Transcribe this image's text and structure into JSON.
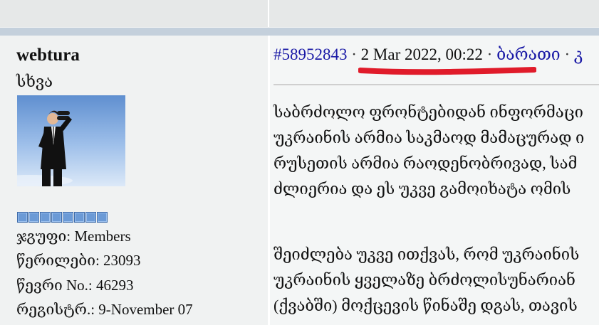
{
  "user": {
    "name": "webtura",
    "title": "სხვა",
    "rank_pips": 8,
    "stats": [
      "ჯგუფი: Members",
      "წერილები: 23093",
      "წევრი No.: 46293",
      "რეგისტრ.: 9-November 07"
    ]
  },
  "post": {
    "id_link": "#58952843",
    "separator": "·",
    "date": "2 Mar 2022, 00:22",
    "action_link": "ბარათი",
    "trailing_separator": "·",
    "trailing_fragment": "კ",
    "paragraph1": [
      "საბრძოლო ფრონტებიდან ინფორმაცი",
      "უკრაინის არმია საკმაოდ მამაცურად ი",
      "რუსეთის არმია რაოდენობრივად, სამ",
      "ძლიერია და ეს უკვე გამოიხატა ომის"
    ],
    "paragraph2": [
      "შეიძლება უკვე ითქვას, რომ უკრაინის",
      "უკრაინის ყველაზე ბრძოლისუნარიან",
      "(ქვაბში) მოქცევის წინაშე დგას, თავის"
    ]
  },
  "colors": {
    "link": "#1a1aa6",
    "underline_annotation": "#e01b2a",
    "band": "#c4d0dc",
    "rank_pip": "#6b9ad6"
  }
}
